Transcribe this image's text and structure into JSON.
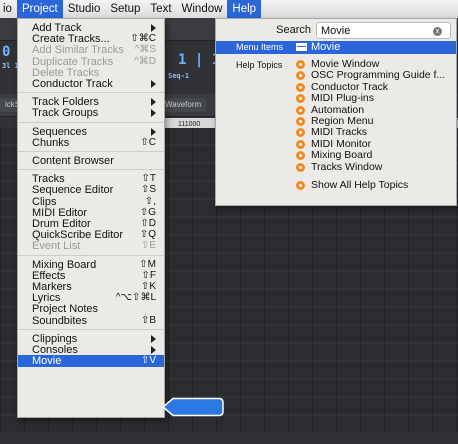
{
  "menubar": {
    "items": [
      {
        "label": "io",
        "active": false
      },
      {
        "label": "Project",
        "active": true
      },
      {
        "label": "Studio",
        "active": false
      },
      {
        "label": "Setup",
        "active": false
      },
      {
        "label": "Text",
        "active": false
      },
      {
        "label": "Window",
        "active": false
      },
      {
        "label": "Help",
        "active": true
      }
    ]
  },
  "background": {
    "counter": "1 | 1",
    "waveform_tab": "Waveform",
    "ruler_label": "111000",
    "ruler_num_a": "2",
    "ruler_num_b": "5",
    "seq_label": "Seq-1",
    "left_edge_label": "0",
    "left_edge_small": "3l 1",
    "quick_label": "ickS"
  },
  "project_menu": {
    "items": [
      {
        "label": "Add Track",
        "shortcut": "",
        "submenu": true,
        "disabled": false
      },
      {
        "label": "Create Tracks...",
        "shortcut": "⇧⌘C",
        "submenu": false,
        "disabled": false
      },
      {
        "label": "Add Similar Tracks",
        "shortcut": "^⌘S",
        "submenu": false,
        "disabled": true
      },
      {
        "label": "Duplicate Tracks",
        "shortcut": "^⌘D",
        "submenu": false,
        "disabled": true
      },
      {
        "label": "Delete Tracks",
        "shortcut": "",
        "submenu": false,
        "disabled": true
      },
      {
        "label": "Conductor Track",
        "shortcut": "",
        "submenu": true,
        "disabled": false
      },
      {
        "sep": true
      },
      {
        "label": "Track Folders",
        "shortcut": "",
        "submenu": true,
        "disabled": false
      },
      {
        "label": "Track Groups",
        "shortcut": "",
        "submenu": true,
        "disabled": false
      },
      {
        "sep": true
      },
      {
        "label": "Sequences",
        "shortcut": "",
        "submenu": true,
        "disabled": false
      },
      {
        "label": "Chunks",
        "shortcut": "⇧C",
        "submenu": false,
        "disabled": false
      },
      {
        "sep": true
      },
      {
        "label": "Content Browser",
        "shortcut": "",
        "submenu": false,
        "disabled": false
      },
      {
        "sep": true
      },
      {
        "label": "Tracks",
        "shortcut": "⇧T",
        "submenu": false,
        "disabled": false
      },
      {
        "label": "Sequence Editor",
        "shortcut": "⇧S",
        "submenu": false,
        "disabled": false
      },
      {
        "label": "Clips",
        "shortcut": "⇧,",
        "submenu": false,
        "disabled": false
      },
      {
        "label": "MIDI Editor",
        "shortcut": "⇧G",
        "submenu": false,
        "disabled": false
      },
      {
        "label": "Drum Editor",
        "shortcut": "⇧D",
        "submenu": false,
        "disabled": false
      },
      {
        "label": "QuickScribe Editor",
        "shortcut": "⇧Q",
        "submenu": false,
        "disabled": false
      },
      {
        "label": "Event List",
        "shortcut": "⇧E",
        "submenu": false,
        "disabled": true
      },
      {
        "sep": true
      },
      {
        "label": "Mixing Board",
        "shortcut": "⇧M",
        "submenu": false,
        "disabled": false
      },
      {
        "label": "Effects",
        "shortcut": "⇧F",
        "submenu": false,
        "disabled": false
      },
      {
        "label": "Markers",
        "shortcut": "⇧K",
        "submenu": false,
        "disabled": false
      },
      {
        "label": "Lyrics",
        "shortcut": "^⌥⇧⌘L",
        "submenu": false,
        "disabled": false
      },
      {
        "label": "Project Notes",
        "shortcut": "",
        "submenu": false,
        "disabled": false
      },
      {
        "label": "Soundbites",
        "shortcut": "⇧B",
        "submenu": false,
        "disabled": false
      },
      {
        "sep": true
      },
      {
        "label": "Clippings",
        "shortcut": "",
        "submenu": true,
        "disabled": false
      },
      {
        "label": "Consoles",
        "shortcut": "",
        "submenu": true,
        "disabled": false
      },
      {
        "label": "Movie",
        "shortcut": "⇧V",
        "submenu": false,
        "disabled": false,
        "highlighted": true
      }
    ]
  },
  "help_panel": {
    "search_label": "Search",
    "search_value": "Movie",
    "clear_icon": "x",
    "menu_items_label": "Menu Items",
    "menu_item_result": "Movie",
    "help_topics_label": "Help Topics",
    "help_topics": [
      "Movie Window",
      "OSC Programming Guide f...",
      "Conductor Track",
      "MIDI Plug-ins",
      "Automation",
      "Region Menu",
      "MIDI Tracks",
      "MIDI Monitor",
      "Mixing Board",
      "Tracks Window"
    ],
    "show_all_label": "Show All Help Topics"
  },
  "colors": {
    "accent": "#2b66d9",
    "help_icon": "#f08a24",
    "menu_bg": "#eceae6"
  }
}
